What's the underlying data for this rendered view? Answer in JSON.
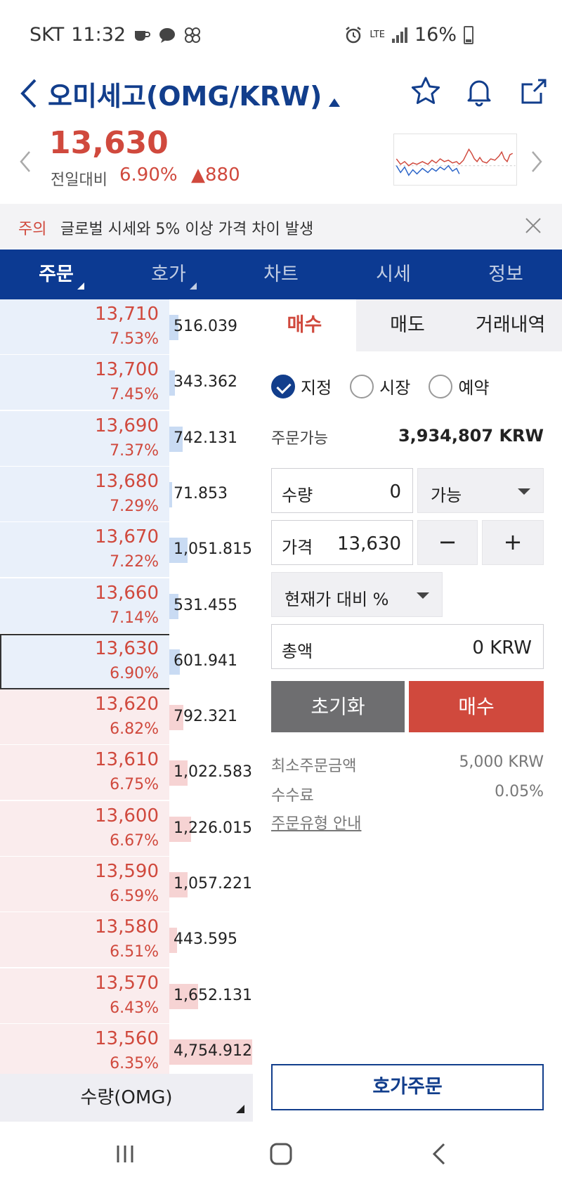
{
  "status": {
    "carrier": "SKT",
    "time": "11:32",
    "network": "LTE",
    "battery": "16%"
  },
  "header": {
    "title": "오미세고(OMG/KRW)"
  },
  "quote": {
    "price": "13,630",
    "change_label": "전일대비",
    "change_pct": "6.90%",
    "change_amt": "▲880"
  },
  "notice": {
    "tag": "주의",
    "message": "글로벌 시세와 5% 이상 가격 차이 발생"
  },
  "tabs": [
    {
      "label": "주문"
    },
    {
      "label": "호가"
    },
    {
      "label": "차트"
    },
    {
      "label": "시세"
    },
    {
      "label": "정보"
    }
  ],
  "orderbook": {
    "rows": [
      {
        "side": "ask",
        "price": "13,710",
        "pct": "7.53%",
        "qty": "516.039",
        "level": 0.11
      },
      {
        "side": "ask",
        "price": "13,700",
        "pct": "7.45%",
        "qty": "343.362",
        "level": 0.07
      },
      {
        "side": "ask",
        "price": "13,690",
        "pct": "7.37%",
        "qty": "742.131",
        "level": 0.16
      },
      {
        "side": "ask",
        "price": "13,680",
        "pct": "7.29%",
        "qty": "71.853",
        "level": 0.02
      },
      {
        "side": "ask",
        "price": "13,670",
        "pct": "7.22%",
        "qty": "1,051.815",
        "level": 0.22
      },
      {
        "side": "ask",
        "price": "13,660",
        "pct": "7.14%",
        "qty": "531.455",
        "level": 0.11
      },
      {
        "side": "ask",
        "price": "13,630",
        "pct": "6.90%",
        "qty": "601.941",
        "level": 0.13,
        "current": true
      },
      {
        "side": "bid",
        "price": "13,620",
        "pct": "6.82%",
        "qty": "792.321",
        "level": 0.17
      },
      {
        "side": "bid",
        "price": "13,610",
        "pct": "6.75%",
        "qty": "1,022.583",
        "level": 0.22
      },
      {
        "side": "bid",
        "price": "13,600",
        "pct": "6.67%",
        "qty": "1,226.015",
        "level": 0.26
      },
      {
        "side": "bid",
        "price": "13,590",
        "pct": "6.59%",
        "qty": "1,057.221",
        "level": 0.22
      },
      {
        "side": "bid",
        "price": "13,580",
        "pct": "6.51%",
        "qty": "443.595",
        "level": 0.09
      },
      {
        "side": "bid",
        "price": "13,570",
        "pct": "6.43%",
        "qty": "1,652.131",
        "level": 0.35
      },
      {
        "side": "bid",
        "price": "13,560",
        "pct": "6.35%",
        "qty": "4,754.912",
        "level": 1.0
      }
    ],
    "footer_label": "수량(OMG)"
  },
  "order": {
    "tabs": [
      "매수",
      "매도",
      "거래내역"
    ],
    "types": [
      {
        "label": "지정",
        "checked": true
      },
      {
        "label": "시장",
        "checked": false
      },
      {
        "label": "예약",
        "checked": false
      }
    ],
    "available_label": "주문가능",
    "available_value": "3,934,807 KRW",
    "qty_label": "수량",
    "qty_value": "0",
    "qty_option": "가능",
    "price_label": "가격",
    "price_value": "13,630",
    "minus": "−",
    "plus": "+",
    "pct_dropdown": "현재가 대비 %",
    "total_label": "총액",
    "total_value": "0 KRW",
    "reset_label": "초기화",
    "buy_label": "매수",
    "min_order_label": "최소주문금액",
    "min_order_value": "5,000 KRW",
    "fee_label": "수수료",
    "fee_value": "0.05%",
    "guide_link": "주문유형 안내",
    "hoga_order": "호가주문"
  },
  "colors": {
    "brand": "#0c3a92",
    "up": "#d0493d"
  }
}
